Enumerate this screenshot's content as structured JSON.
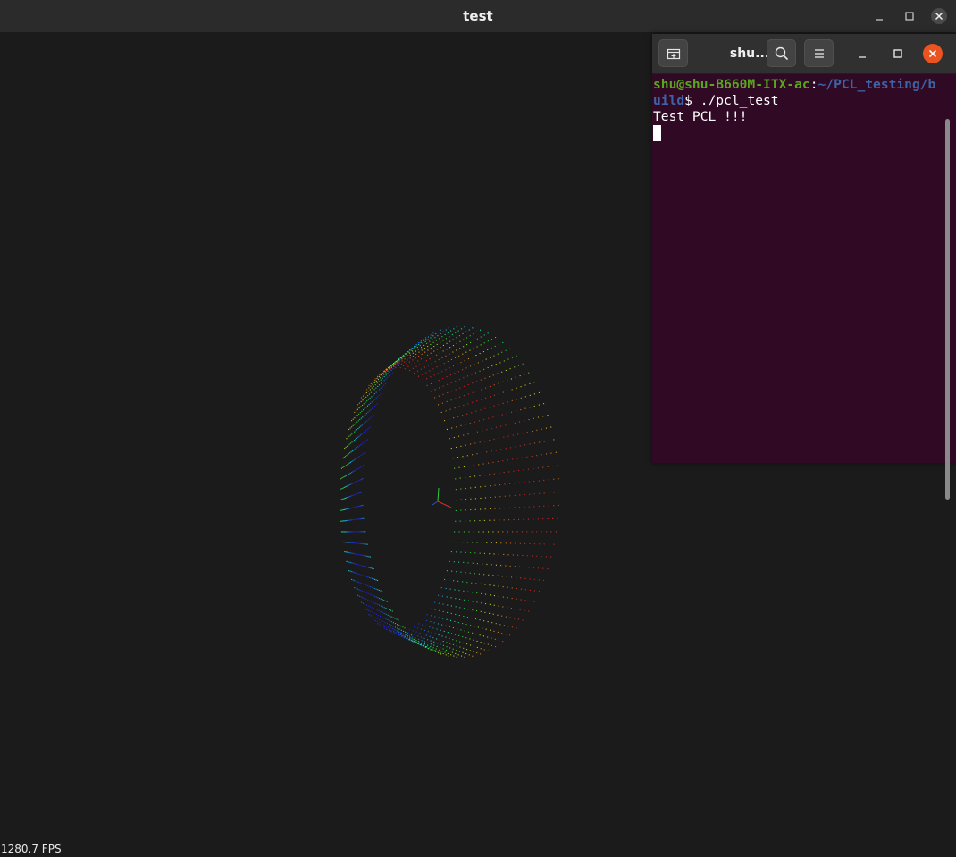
{
  "window": {
    "title": "test"
  },
  "viewer": {
    "fps": "1280.7 FPS"
  },
  "terminal": {
    "title": "shu...",
    "prompt_user": "shu@shu-B660M-ITX-ac",
    "prompt_sep": ":",
    "prompt_path_line1": "~/PCL_testing/b",
    "prompt_path_line2": "uild",
    "prompt_symbol": "$ ",
    "command": "./pcl_test",
    "output": "Test PCL !!!"
  },
  "colors": {
    "terminal_bg": "#300a24",
    "prompt_user": "#5aa61d",
    "prompt_path": "#3f63a6",
    "close_button": "#e95420"
  },
  "icons": [
    "minimize-icon",
    "maximize-icon",
    "close-icon",
    "new-tab-icon",
    "search-icon",
    "hamburger-menu-icon"
  ]
}
